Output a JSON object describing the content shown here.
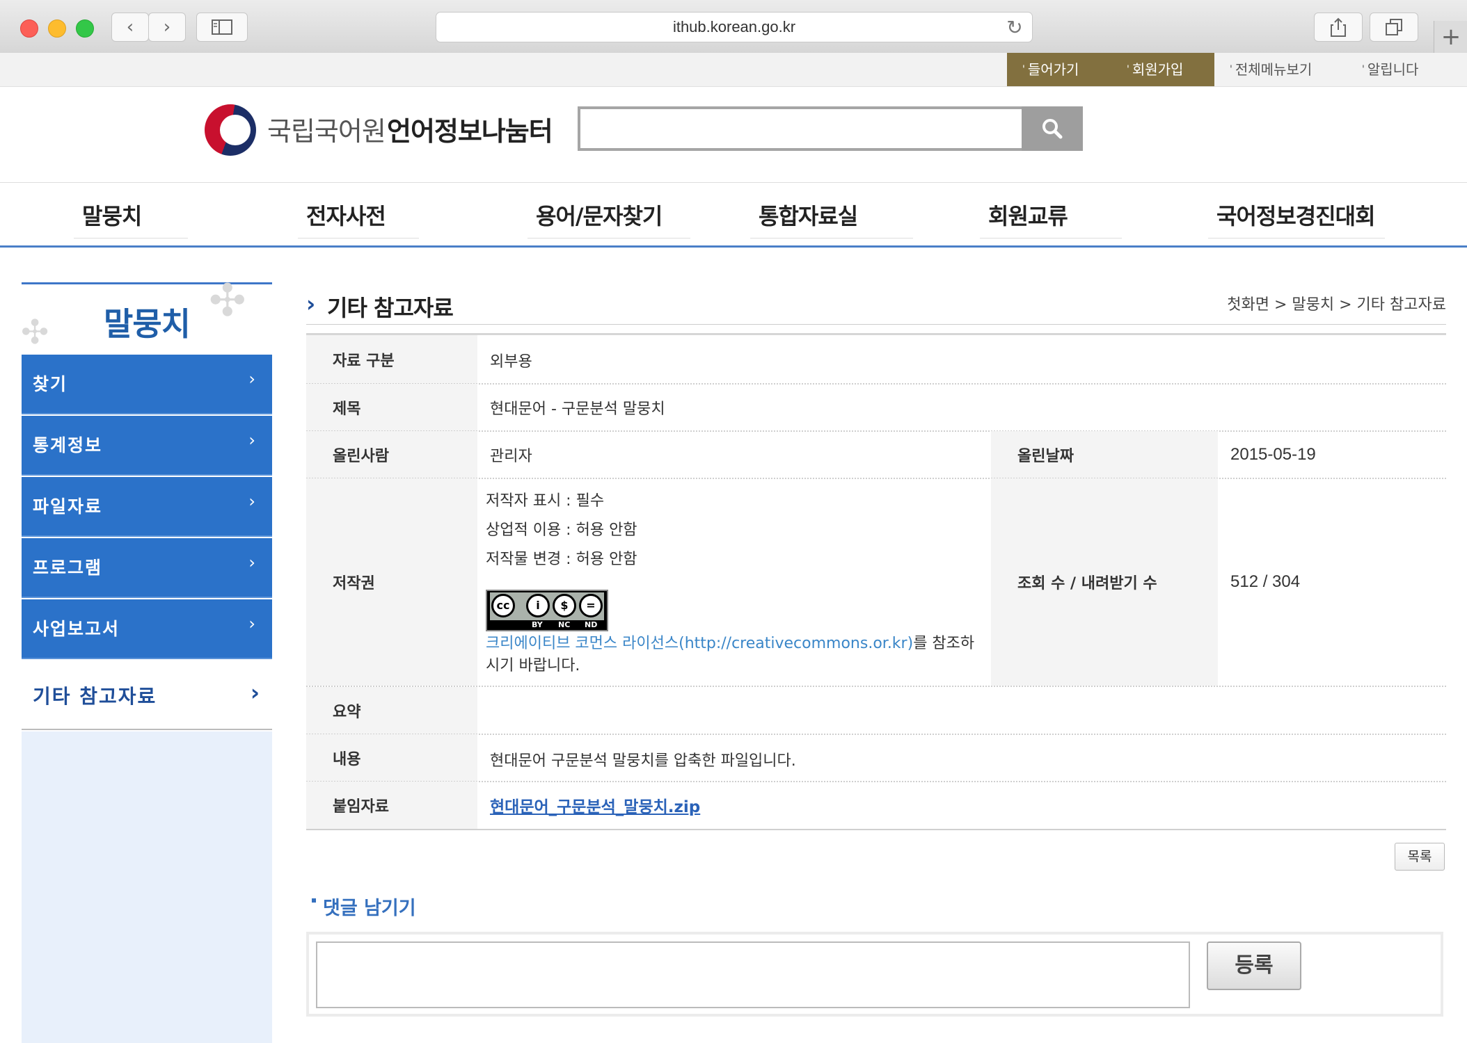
{
  "browser": {
    "url": "ithub.korean.go.kr"
  },
  "utility_nav": {
    "login": "들어가기",
    "signup": "회원가입",
    "sitemap": "전체메뉴보기",
    "notice": "알립니다"
  },
  "header": {
    "org_name": "국립국어원",
    "site_name": "언어정보나눔터",
    "search_placeholder": ""
  },
  "main_nav": [
    "말뭉치",
    "전자사전",
    "용어/문자찾기",
    "통합자료실",
    "회원교류",
    "국어정보경진대회"
  ],
  "sidebar": {
    "title": "말뭉치",
    "items": [
      "찾기",
      "통계정보",
      "파일자료",
      "프로그램",
      "사업보고서"
    ],
    "active": "기타 참고자료"
  },
  "content": {
    "title": "기타 참고자료",
    "breadcrumb": "첫화면 > 말뭉치 > 기타 참고자료",
    "rows": {
      "category_label": "자료 구분",
      "category_value": "외부용",
      "subject_label": "제목",
      "subject_value": "현대문어 - 구문분석 말뭉치",
      "uploader_label": "올린사람",
      "uploader_value": "관리자",
      "date_label": "올린날짜",
      "date_value": "2015-05-19",
      "copyright_label": "저작권",
      "copyright_lines": [
        "저작자 표시 : 필수",
        "상업적 이용 : 허용 안함",
        "저작물 변경 : 허용 안함"
      ],
      "cc_link": "크리에이티브 코먼스 라이선스(http://creativecommons.or.kr)",
      "cc_suffix1": "를 참조하",
      "cc_suffix2": "시기 바랍니다.",
      "views_label": "조회 수 / 내려받기 수",
      "views_value": "512 / 304",
      "summary_label": "요약",
      "summary_value": "",
      "content_label": "내용",
      "content_value": "현대문어 구문분석 말뭉치를 압축한 파일입니다.",
      "attachment_label": "붙임자료",
      "attachment_value": "현대문어_구문분석_말뭉치.zip"
    },
    "cc_badge": {
      "cc": "cc",
      "by": "BY",
      "nc": "NC",
      "nd": "ND"
    },
    "list_button": "목록",
    "comment_title": "댓글 남기기",
    "comment_placeholder": "",
    "register_button": "등록"
  }
}
